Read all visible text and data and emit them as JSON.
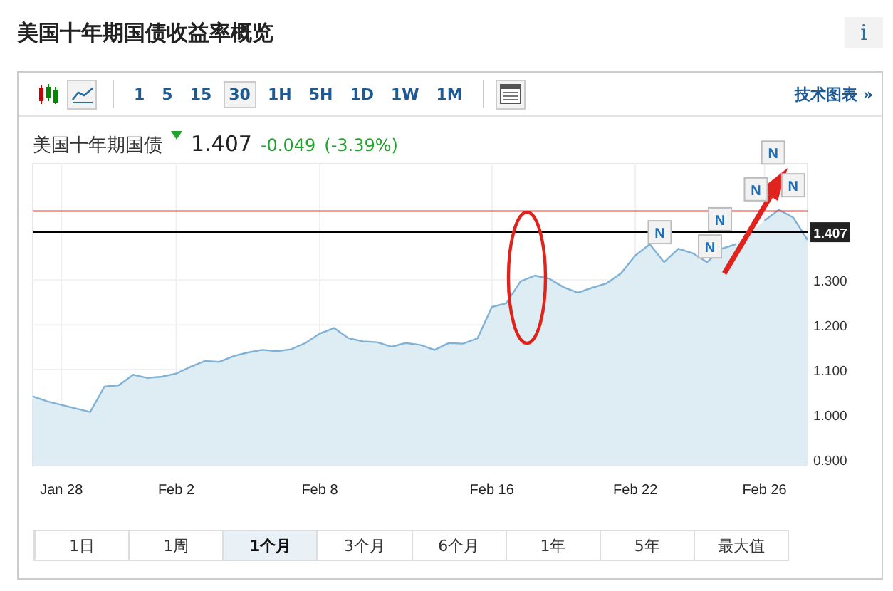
{
  "title": "美国十年期国债收益率概览",
  "info_button": "i",
  "toolbar": {
    "chart_types": [
      {
        "kind": "candles",
        "selected": false
      },
      {
        "kind": "line",
        "selected": true
      }
    ],
    "intervals": [
      {
        "label": "1",
        "selected": false
      },
      {
        "label": "5",
        "selected": false
      },
      {
        "label": "15",
        "selected": false
      },
      {
        "label": "30",
        "selected": true
      },
      {
        "label": "1H",
        "selected": false
      },
      {
        "label": "5H",
        "selected": false
      },
      {
        "label": "1D",
        "selected": false
      },
      {
        "label": "1W",
        "selected": false
      },
      {
        "label": "1M",
        "selected": false
      }
    ],
    "link": "技术图表 »"
  },
  "quote": {
    "name": "美国十年期国债",
    "falling": true,
    "price": "1.407",
    "change": "-0.049",
    "change_percent": "(-3.39%)"
  },
  "chart_data": {
    "type": "area",
    "grid": true,
    "ylim": [
      0.885,
      1.56
    ],
    "categories": [
      null,
      null,
      "Jan 28",
      null,
      null,
      null,
      null,
      null,
      null,
      null,
      "Feb 2",
      null,
      null,
      null,
      null,
      null,
      null,
      null,
      null,
      null,
      "Feb 8",
      null,
      null,
      null,
      null,
      null,
      null,
      null,
      null,
      null,
      null,
      null,
      "Feb 16",
      null,
      null,
      null,
      null,
      null,
      null,
      null,
      null,
      null,
      "Feb 22",
      null,
      null,
      null,
      null,
      null,
      null,
      null,
      null,
      "Feb 26",
      null,
      null,
      null
    ],
    "yticks": [
      {
        "value": 0.9,
        "label": "0.900"
      },
      {
        "value": 1.0,
        "label": "1.000"
      },
      {
        "value": 1.1,
        "label": "1.100"
      },
      {
        "value": 1.2,
        "label": "1.200"
      },
      {
        "value": 1.3,
        "label": "1.300"
      }
    ],
    "series": [
      {
        "color": "#7fb2d6",
        "values": [
          1.04,
          1.029,
          1.021,
          1.013,
          1.005,
          1.062,
          1.065,
          1.088,
          1.081,
          1.084,
          1.091,
          1.106,
          1.119,
          1.117,
          1.13,
          1.138,
          1.144,
          1.141,
          1.145,
          1.159,
          1.18,
          1.193,
          1.17,
          1.163,
          1.161,
          1.151,
          1.159,
          1.155,
          1.144,
          1.159,
          1.158,
          1.17,
          1.24,
          1.248,
          1.297,
          1.31,
          1.303,
          1.284,
          1.272,
          1.283,
          1.293,
          1.315,
          1.355,
          1.38,
          1.34,
          1.37,
          1.36,
          1.34,
          1.37,
          1.38,
          null,
          1.433,
          1.457,
          1.44,
          1.39
        ]
      }
    ],
    "ref_lines": [
      {
        "axis": "y",
        "value": 1.454
      },
      {
        "axis": "y",
        "value": 1.407,
        "label": "1.407"
      }
    ]
  },
  "news_flags": [
    {
      "label": "N"
    },
    {
      "label": "N"
    },
    {
      "label": "N"
    },
    {
      "label": "N"
    },
    {
      "label": "N"
    },
    {
      "label": "N"
    }
  ],
  "ranges": [
    {
      "label": "1日",
      "selected": false
    },
    {
      "label": "1周",
      "selected": false
    },
    {
      "label": "1个月",
      "selected": true
    },
    {
      "label": "3个月",
      "selected": false
    },
    {
      "label": "6个月",
      "selected": false
    },
    {
      "label": "1年",
      "selected": false
    },
    {
      "label": "5年",
      "selected": false
    },
    {
      "label": "最大值",
      "selected": false
    }
  ]
}
